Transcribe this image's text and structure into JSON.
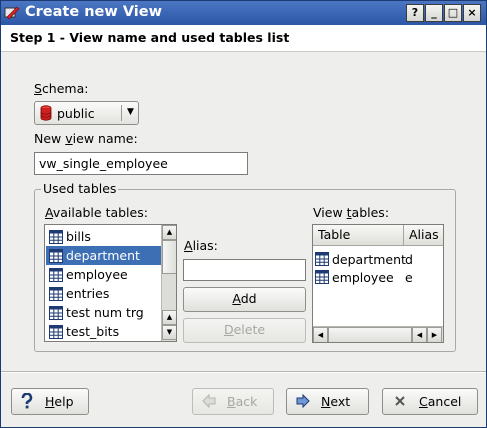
{
  "window": {
    "title": "Create new View",
    "controls": {
      "help": "?",
      "minimize": "_",
      "maximize": "□",
      "close": "×"
    }
  },
  "header": {
    "text": "Step 1 - View name and used tables list"
  },
  "schema": {
    "label_u": "S",
    "label_rest": "chema:",
    "value": "public",
    "icon": "database-icon"
  },
  "view_name": {
    "label_pre": "New ",
    "label_u": "v",
    "label_rest": "iew name:",
    "value": "vw_single_employee"
  },
  "used_tables": {
    "title": "Used tables",
    "available": {
      "label_u": "A",
      "label_rest": "vailable tables:",
      "items": [
        "bills",
        "department",
        "employee",
        "entries",
        "test num trg",
        "test_bits"
      ],
      "selected_index": 1
    },
    "alias": {
      "label_u": "A",
      "label_rest": "lias:",
      "value": ""
    },
    "add_button": {
      "u": "A",
      "rest": "dd"
    },
    "delete_button": {
      "u": "D",
      "rest": "elete"
    },
    "view_tables": {
      "label_pre": "View ",
      "label_u": "t",
      "label_rest": "ables:",
      "columns": [
        "Table",
        "Alias"
      ],
      "rows": [
        {
          "table": "department",
          "alias": "d"
        },
        {
          "table": "employee",
          "alias": "e"
        }
      ]
    }
  },
  "footer": {
    "help": {
      "u": "H",
      "rest": "elp",
      "icon": "question-icon"
    },
    "back": {
      "u": "B",
      "rest": "ack",
      "icon": "arrow-left-icon"
    },
    "next": {
      "u": "N",
      "rest": "ext",
      "icon": "arrow-right-icon"
    },
    "cancel": {
      "u": "C",
      "rest": "ancel",
      "icon": "close-icon"
    }
  },
  "colors": {
    "titlebar": "#2b57a6",
    "selection": "#3d6fb4",
    "table_icon": "#1d3a73"
  }
}
